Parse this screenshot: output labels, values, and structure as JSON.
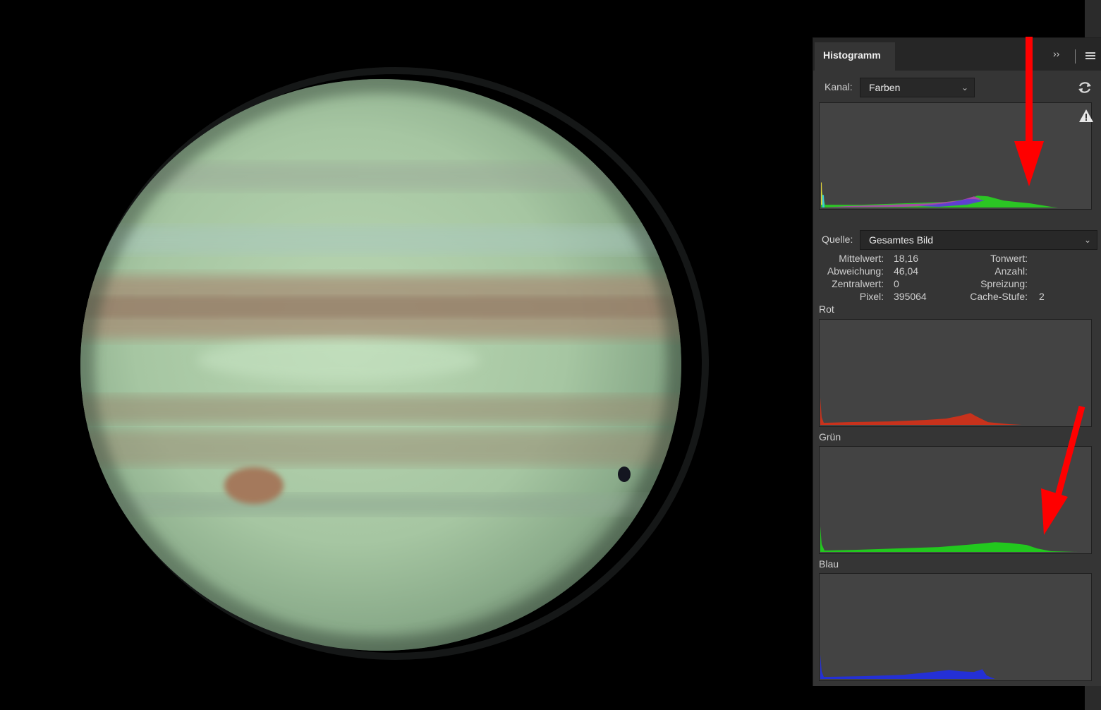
{
  "panel": {
    "tab_title": "Histogramm",
    "collapse_label": "››",
    "channel": {
      "label": "Kanal:",
      "value": "Farben"
    },
    "source": {
      "label": "Quelle:",
      "value": "Gesamtes Bild"
    },
    "stats": {
      "mean": {
        "label": "Mittelwert:",
        "value": "18,16"
      },
      "deviation": {
        "label": "Abweichung:",
        "value": "46,04"
      },
      "median": {
        "label": "Zentralwert:",
        "value": "0"
      },
      "pixels": {
        "label": "Pixel:",
        "value": "395064"
      },
      "level": {
        "label": "Tonwert:",
        "value": ""
      },
      "count": {
        "label": "Anzahl:",
        "value": ""
      },
      "percentile": {
        "label": "Spreizung:",
        "value": ""
      },
      "cache_level": {
        "label": "Cache-Stufe:",
        "value": "2"
      }
    },
    "channels": [
      {
        "key": "red",
        "label": "Rot",
        "color": "#c8321c"
      },
      {
        "key": "green",
        "label": "Grün",
        "color": "#22c81e"
      },
      {
        "key": "blue",
        "label": "Blau",
        "color": "#2430d6"
      }
    ]
  },
  "colors": {
    "annotation_arrow": "#ff0000",
    "panel_bg": "#353535",
    "histogram_bg": "#434343"
  },
  "icons": [
    "collapse-icon",
    "menu-icon",
    "refresh-icon",
    "chevron-down-icon",
    "warning-icon"
  ]
}
